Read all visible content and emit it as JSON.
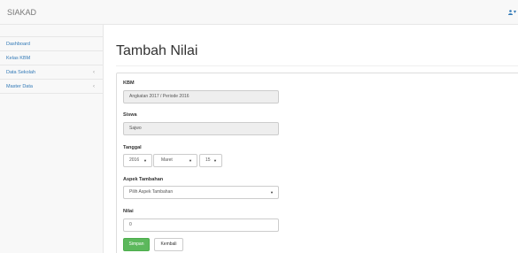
{
  "navbar": {
    "brand": "SIAKAD",
    "user_caret": "▾"
  },
  "sidebar": {
    "items": [
      {
        "label": "Dashboard",
        "has_submenu": false
      },
      {
        "label": "Kelas KBM",
        "has_submenu": false
      },
      {
        "label": "Data Sekolah",
        "has_submenu": true,
        "chevron": "‹"
      },
      {
        "label": "Master Data",
        "has_submenu": true,
        "chevron": "‹"
      }
    ]
  },
  "page": {
    "title": "Tambah Nilai"
  },
  "form": {
    "kbm": {
      "label": "KBM",
      "value": "Angkatan 2017 / Periode 2016"
    },
    "siswa": {
      "label": "Siswa",
      "value": "Sajwo"
    },
    "tanggal": {
      "label": "Tanggal",
      "year": "2016",
      "month": "Maret",
      "day": "15",
      "caret": "▼"
    },
    "aspek": {
      "label": "Aspek Tambahan",
      "selected": "Pilih Aspek Tambahan",
      "caret": "▼"
    },
    "nilai": {
      "label": "Nilai",
      "value": "0"
    },
    "buttons": {
      "save": "Simpan",
      "back": "Kembali"
    }
  },
  "colors": {
    "link": "#337ab7",
    "success": "#5cb85c",
    "disabled_bg": "#eeeeee"
  }
}
